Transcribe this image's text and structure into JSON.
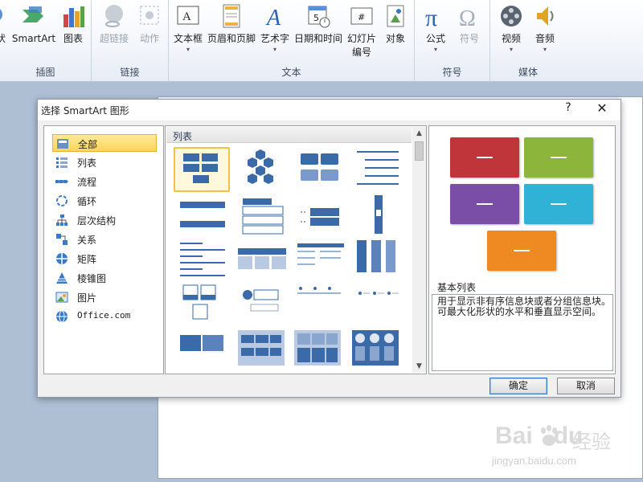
{
  "ribbon": {
    "groups": [
      {
        "label": "插图",
        "buttons": [
          "SmartArt",
          "图表"
        ]
      },
      {
        "label": "链接",
        "buttons": [
          "超链接",
          "动作"
        ]
      },
      {
        "label": "文本",
        "buttons": [
          "文本框",
          "页眉和页脚",
          "艺术字",
          "日期和时间",
          "幻灯片\n编号",
          "对象"
        ]
      },
      {
        "label": "符号",
        "buttons": [
          "公式",
          "符号"
        ]
      },
      {
        "label": "媒体",
        "buttons": [
          "视频",
          "音频"
        ]
      }
    ],
    "partial_label": "状",
    "icons": {
      "smartart": "smartart-icon",
      "chart": "chart-icon",
      "hyperlink": "hyperlink-icon",
      "action": "action-icon",
      "textbox": "textbox-icon",
      "header_footer": "header-footer-icon",
      "wordart": "wordart-icon",
      "datetime": "datetime-icon",
      "slide_number": "slide-number-icon",
      "object": "object-icon",
      "equation": "equation-icon",
      "symbol": "symbol-icon",
      "video": "video-icon",
      "audio": "audio-icon"
    }
  },
  "dialog": {
    "title": "选择 SmartArt 图形",
    "help": "?",
    "close": "✕",
    "categories": [
      {
        "label": "全部",
        "icon": "all-icon",
        "selected": true
      },
      {
        "label": "列表",
        "icon": "list-icon",
        "selected": false
      },
      {
        "label": "流程",
        "icon": "process-icon",
        "selected": false
      },
      {
        "label": "循环",
        "icon": "cycle-icon",
        "selected": false
      },
      {
        "label": "层次结构",
        "icon": "hierarchy-icon",
        "selected": false
      },
      {
        "label": "关系",
        "icon": "relationship-icon",
        "selected": false
      },
      {
        "label": "矩阵",
        "icon": "matrix-icon",
        "selected": false
      },
      {
        "label": "棱锥图",
        "icon": "pyramid-icon",
        "selected": false
      },
      {
        "label": "图片",
        "icon": "picture-icon",
        "selected": false
      },
      {
        "label": "Office.com",
        "icon": "office-com-icon",
        "selected": false
      }
    ],
    "gallery_header": "列表",
    "preview": {
      "name": "基本列表",
      "description": "用于显示非有序信息块或者分组信息块。可最大化形状的水平和垂直显示空间。",
      "box_colors": [
        "#c0353a",
        "#8cb53b",
        "#7a4da6",
        "#30b1d6",
        "#ef8a23"
      ]
    },
    "ok_label": "确定",
    "cancel_label": "取消"
  },
  "watermark": {
    "brand": "Bai",
    "brand_suffix": "du",
    "cn": "经验",
    "url": "jingyan.baidu.com"
  }
}
